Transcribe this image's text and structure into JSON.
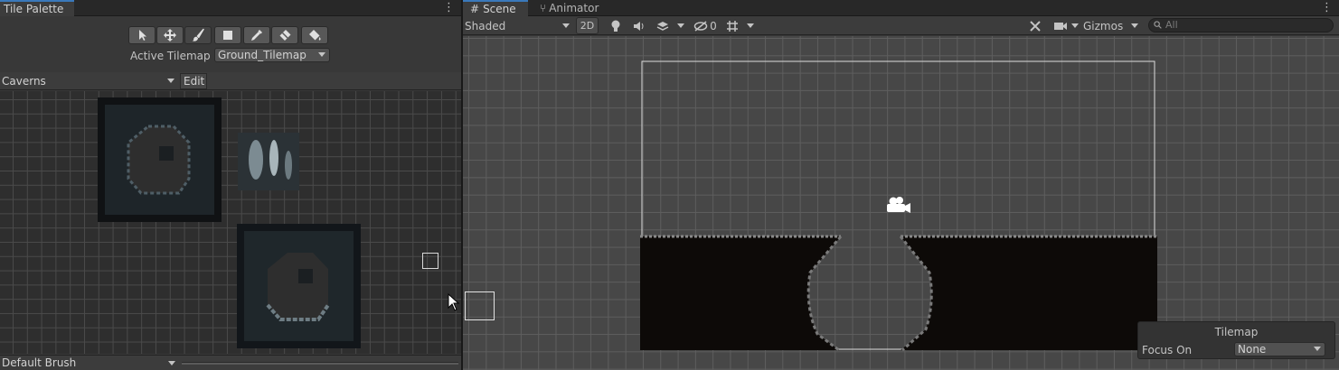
{
  "tile_palette": {
    "tab_title": "Tile Palette",
    "menu_icon": "kebab-menu-icon",
    "tools": [
      {
        "name": "select-tool",
        "icon": "arrow-cursor-icon",
        "active": false
      },
      {
        "name": "move-tool",
        "icon": "move-arrows-icon",
        "active": false
      },
      {
        "name": "paint-brush-tool",
        "icon": "paint-brush-icon",
        "active": true
      },
      {
        "name": "box-fill-tool",
        "icon": "box-fill-icon",
        "active": false
      },
      {
        "name": "picker-tool",
        "icon": "eyedropper-icon",
        "active": false
      },
      {
        "name": "eraser-tool",
        "icon": "eraser-icon",
        "active": false
      },
      {
        "name": "fill-tool",
        "icon": "paint-bucket-icon",
        "active": false
      }
    ],
    "active_tilemap_label": "Active Tilemap",
    "active_tilemap_value": "Ground_Tilemap",
    "palette_value": "Caverns",
    "edit_label": "Edit",
    "brush_value": "Default Brush"
  },
  "scene": {
    "tabs": [
      {
        "label": "Scene",
        "icon": "grid-hash-icon",
        "active": true
      },
      {
        "label": "Animator",
        "icon": "animator-fork-icon",
        "active": false
      }
    ],
    "toolbar": {
      "shading_mode": "Shaded",
      "mode_2d_label": "2D",
      "lighting_icon": "lightbulb-icon",
      "audio_icon": "speaker-icon",
      "effects_icon": "layers-icon",
      "hidden_count": "0",
      "hidden_icon": "eye-slash-icon",
      "grid_icon": "grid-snap-icon",
      "tools_icon": "wrench-icon",
      "camera_icon": "camera-icon",
      "gizmos_label": "Gizmos",
      "search_placeholder": "All"
    },
    "overlay": {
      "title": "Tilemap",
      "focus_label": "Focus On",
      "focus_value": "None"
    }
  }
}
